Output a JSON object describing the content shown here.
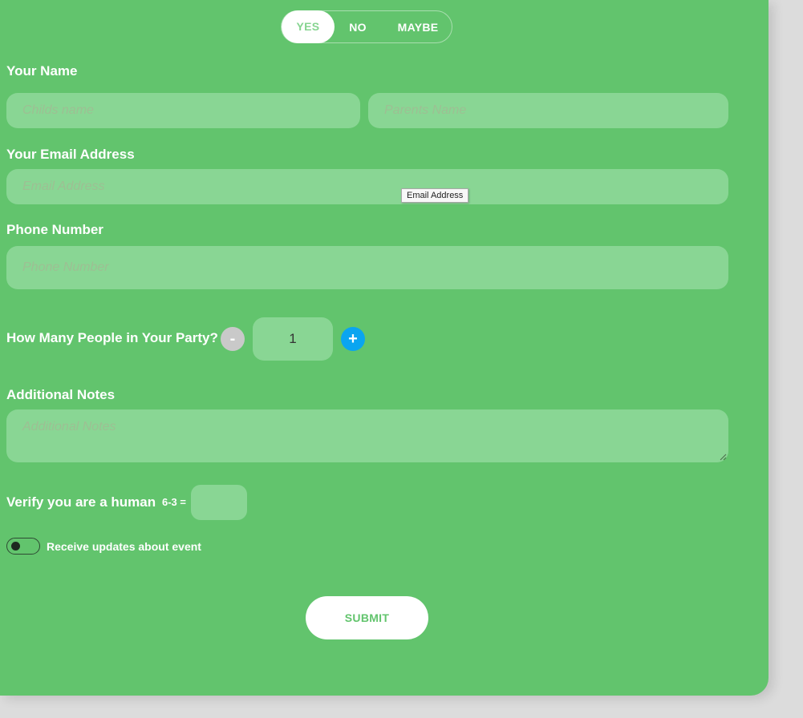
{
  "attendance": {
    "options": [
      "YES",
      "NO",
      "MAYBE"
    ],
    "selected": "YES"
  },
  "name": {
    "label": "Your Name",
    "child_placeholder": "Childs name",
    "parent_placeholder": "Parents Name"
  },
  "email": {
    "label": "Your Email Address",
    "placeholder": "Email Address",
    "tooltip": "Email Address"
  },
  "phone": {
    "label": "Phone Number",
    "placeholder": "Phone Number"
  },
  "party": {
    "label": "How Many People in Your Party?",
    "minus": "-",
    "plus": "+",
    "count": "1"
  },
  "notes": {
    "label": "Additional Notes",
    "placeholder": "Additional Notes"
  },
  "captcha": {
    "label": "Verify you are a human",
    "expression": "6-3 ="
  },
  "updates": {
    "label": "Receive updates about event",
    "enabled": false
  },
  "submit_label": "SUBMIT",
  "colors": {
    "background": "#62c46d",
    "field": "#89d694",
    "plus_button": "#0aa5f0",
    "minus_button": "#c9c9c9"
  }
}
